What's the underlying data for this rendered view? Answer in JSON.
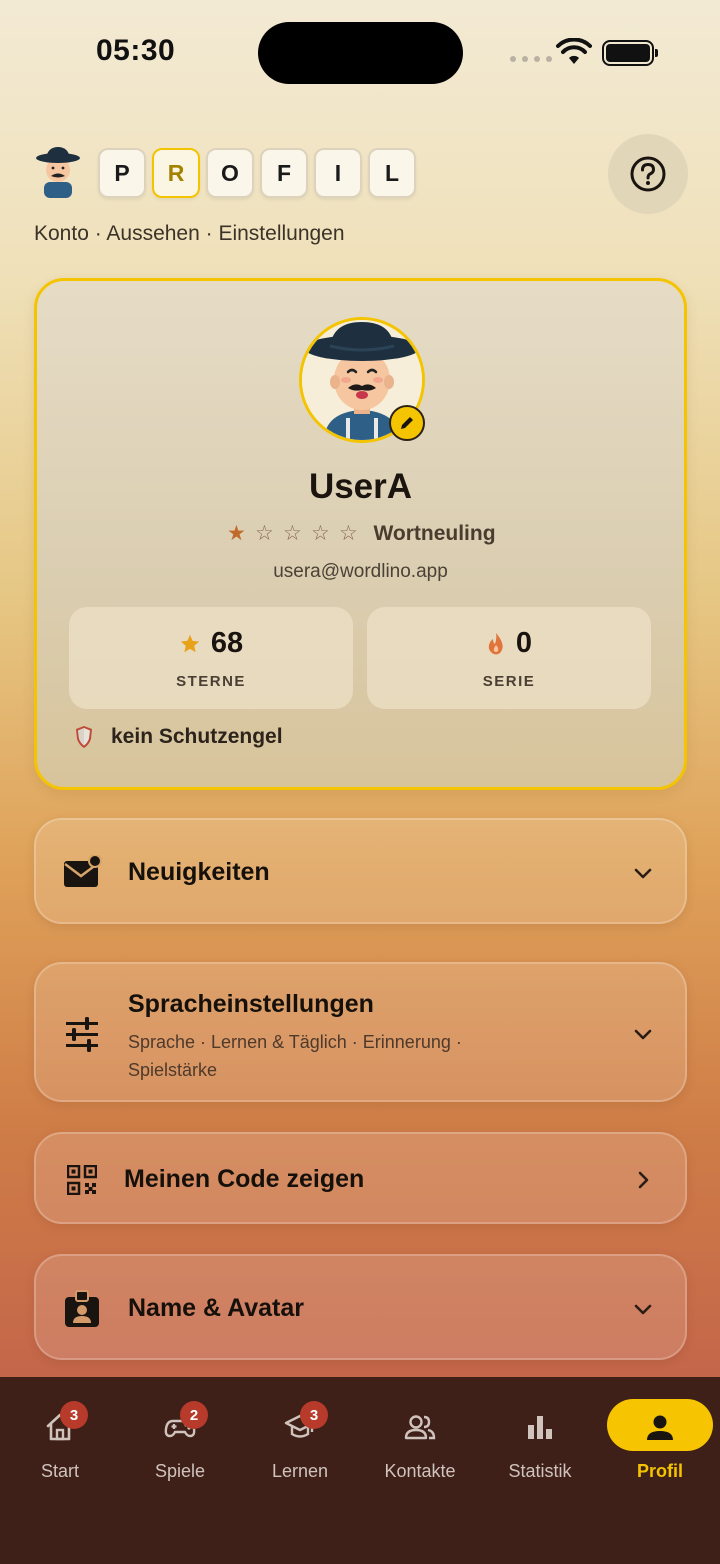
{
  "status_bar": {
    "time": "05:30"
  },
  "header": {
    "title_letters": [
      "P",
      "R",
      "O",
      "F",
      "I",
      "L"
    ],
    "subnav": "Konto · Aussehen · Einstellungen"
  },
  "profile": {
    "username": "UserA",
    "stars_filled": 1,
    "stars_total": 5,
    "rank": "Wortneuling",
    "email": "usera@wordlino.app",
    "stats": [
      {
        "value": "68",
        "label": "STERNE",
        "icon": "star-icon"
      },
      {
        "value": "0",
        "label": "SERIE",
        "icon": "flame-icon"
      }
    ],
    "guardian": "kein Schutzengel"
  },
  "sections": [
    {
      "title": "Neuigkeiten",
      "icon": "mail-icon"
    },
    {
      "title": "Spracheinstellungen",
      "subtitle": "Sprache · Lernen & Täglich · Erinnerung · Spielstärke",
      "icon": "sliders-icon"
    },
    {
      "title": "Meinen Code zeigen",
      "icon": "qr-code-icon"
    },
    {
      "title": "Name & Avatar",
      "icon": "id-badge-icon"
    }
  ],
  "bottom_nav": [
    {
      "label": "Start",
      "badge": "3",
      "icon": "home-icon"
    },
    {
      "label": "Spiele",
      "badge": "2",
      "icon": "gamepad-icon"
    },
    {
      "label": "Lernen",
      "badge": "3",
      "icon": "graduation-cap-icon"
    },
    {
      "label": "Kontakte",
      "icon": "contacts-icon"
    },
    {
      "label": "Statistik",
      "icon": "bar-chart-icon"
    },
    {
      "label": "Profil",
      "icon": "user-icon",
      "active": true
    }
  ],
  "colors": {
    "accent": "#f4c400",
    "nav_bg": "#3e2019",
    "badge": "#b83a2a"
  }
}
